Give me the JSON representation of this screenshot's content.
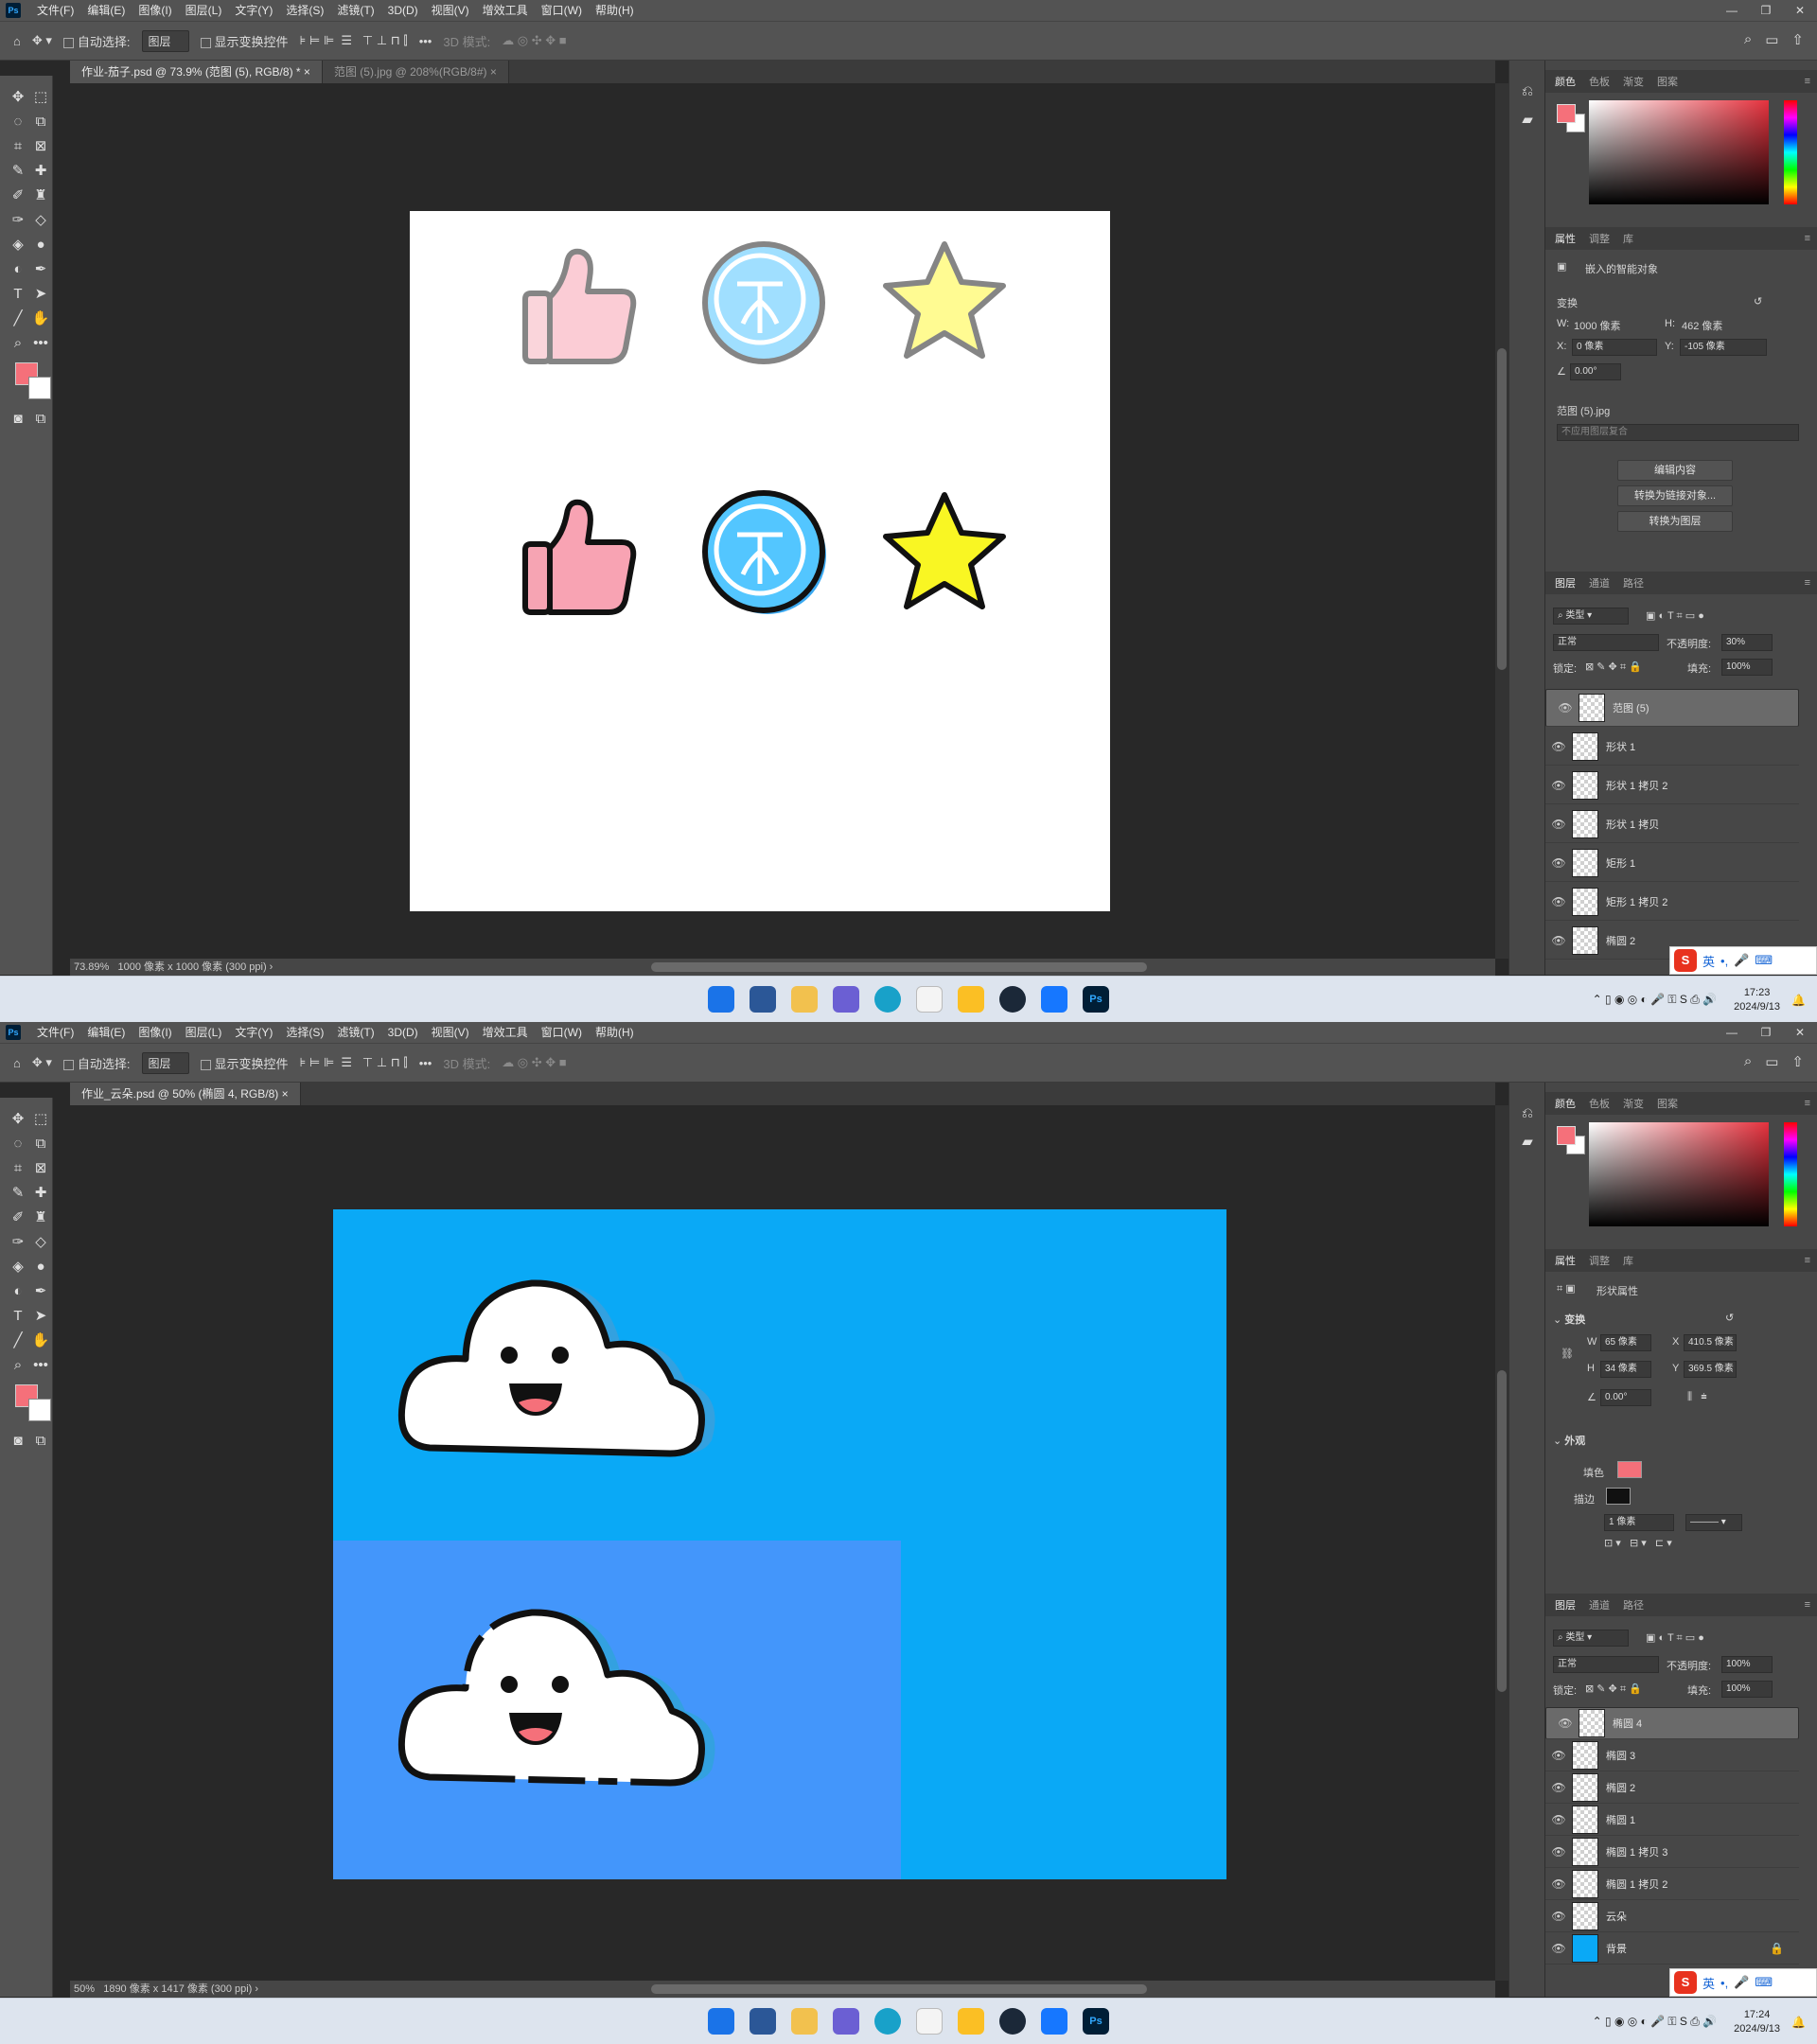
{
  "menu": [
    "文件(F)",
    "编辑(E)",
    "图像(I)",
    "图层(L)",
    "文字(Y)",
    "选择(S)",
    "滤镜(T)",
    "3D(D)",
    "视图(V)",
    "增效工具",
    "窗口(W)",
    "帮助(H)"
  ],
  "options": {
    "auto_select": "自动选择:",
    "layer_select": "图层",
    "show_transform": "显示变换控件",
    "mode3d": "3D 模式:"
  },
  "panel_tabs": {
    "color": [
      "颜色",
      "色板",
      "渐变",
      "图案"
    ],
    "props": [
      "属性",
      "调整",
      "库"
    ],
    "layers": [
      "图层",
      "通道",
      "路径"
    ]
  },
  "top": {
    "tabs": [
      {
        "label": "作业-茄子.psd @ 73.9% (范图 (5), RGB/8) *",
        "close": "×"
      },
      {
        "label": "范图 (5).jpg @ 208%(RGB/8#)",
        "close": "×"
      }
    ],
    "status": {
      "zoom": "73.89%",
      "doc": "1000 像素 x 1000 像素 (300 ppi)"
    },
    "props": {
      "type": "嵌入的智能对象",
      "transform": "变换",
      "w_label": "W:",
      "w": "1000 像素",
      "h_label": "H:",
      "h": "462 像素",
      "x_label": "X:",
      "x": "0 像素",
      "y_label": "Y:",
      "y": "-105 像素",
      "angle": "0.00°",
      "file": "范图 (5).jpg",
      "comp": "不应用图层复合",
      "btn1": "编辑内容",
      "btn2": "转换为链接对象...",
      "btn3": "转换为图层"
    },
    "layers_panel": {
      "kind": "类型",
      "blend": "正常",
      "opacity_label": "不透明度:",
      "opacity": "30%",
      "lock_label": "锁定:",
      "fill_label": "填充:",
      "fill": "100%"
    },
    "layers": [
      "范图 (5)",
      "形状 1",
      "形状 1 拷贝 2",
      "形状 1 拷贝",
      "矩形 1",
      "矩形 1 拷贝 2",
      "椭圆 2"
    ]
  },
  "bottom": {
    "tabs": [
      {
        "label": "作业_云朵.psd @ 50% (椭圆 4, RGB/8)",
        "close": "×"
      }
    ],
    "status": {
      "zoom": "50%",
      "doc": "1890 像素 x 1417 像素 (300 ppi)"
    },
    "props": {
      "type": "形状属性",
      "transform": "变换",
      "w_label": "W",
      "w": "65 像素",
      "h_label": "H",
      "h": "34 像素",
      "x_label": "X",
      "x": "410.5 像素",
      "y_label": "Y",
      "y": "369.5 像素",
      "angle": "0.00°",
      "appearance": "外观",
      "fill_label": "填色",
      "stroke_label": "描边",
      "stroke_width": "1 像素"
    },
    "layers_panel": {
      "kind": "类型",
      "blend": "正常",
      "opacity_label": "不透明度:",
      "opacity": "100%",
      "lock_label": "锁定:",
      "fill_label": "填充:",
      "fill": "100%"
    },
    "layers": [
      "椭圆 4",
      "椭圆 3",
      "椭圆 2",
      "椭圆 1",
      "椭圆 1 拷贝 3",
      "椭圆 1 拷贝 2",
      "云朵",
      "背景"
    ]
  },
  "taskbar": {
    "time_top": "17:23",
    "date_top": "2024/9/13",
    "time_bot": "17:24",
    "date_bot": "2024/9/13",
    "ime": "英"
  },
  "colors": {
    "foreground": "#f5707a",
    "sky": "#0aa9f6",
    "panel_blue": "#4396fb"
  }
}
